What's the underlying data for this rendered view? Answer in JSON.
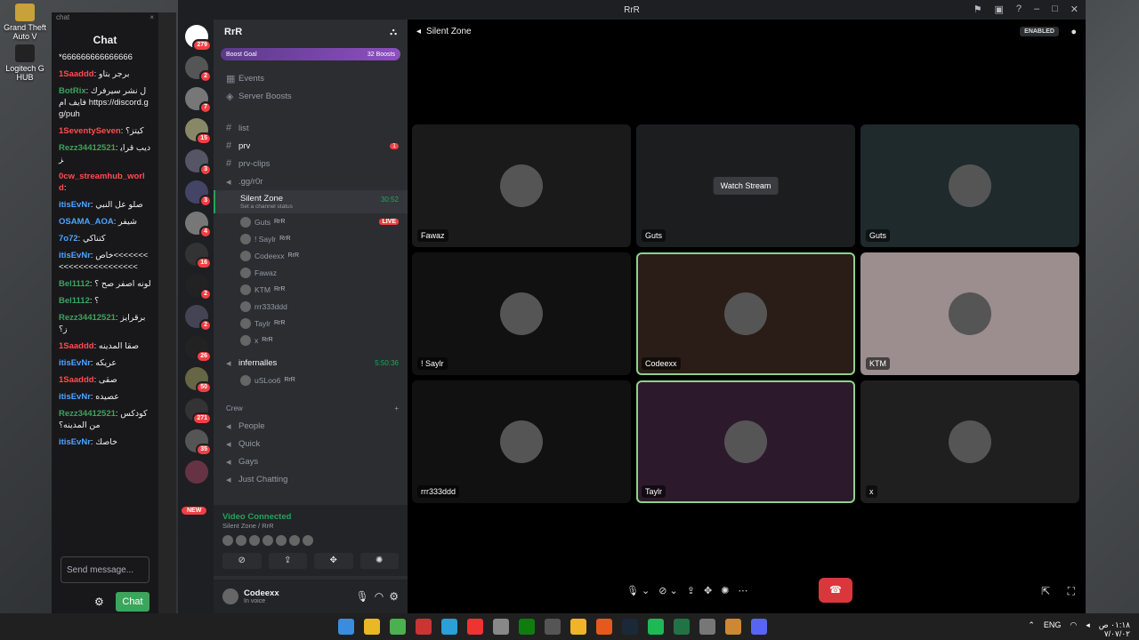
{
  "desktop": {
    "icons": [
      "Grand Theft Auto V",
      "Logitech G HUB"
    ]
  },
  "chat_panel": {
    "top_label": "chat",
    "close": "×",
    "title": "Chat",
    "messages": [
      {
        "user": "",
        "text": "*666666666666666",
        "color": "#efeff1"
      },
      {
        "user": "1Saaddd",
        "text": ": برجر بتاو",
        "color": "#ff4d4d"
      },
      {
        "user": "BotRix",
        "text": ": ل نشر سيرفرك فايف ام https://discord.gg/puh",
        "color": "#3ba55c"
      },
      {
        "user": "1SeventySeven",
        "text": ": كيتز؟",
        "color": "#ff4d4d"
      },
      {
        "user": "Rezz34412521",
        "text": ": ديب قرايز",
        "color": "#3ba55c"
      },
      {
        "user": "0cw_streamhub_world",
        "text": ":",
        "color": "#ff4d4d"
      },
      {
        "user": "itisEvNr",
        "text": ": صلو عل النبي",
        "color": "#4fa3ff"
      },
      {
        "user": "OSAMA_AOA",
        "text": ": شيفر",
        "color": "#4fa3ff"
      },
      {
        "user": "7o72",
        "text": ": كتناكي",
        "color": "#4fa3ff"
      },
      {
        "user": "itisEvNr",
        "text": ": خاص<<<<<<<<<<<<<<<<<<<<<<<",
        "color": "#4fa3ff"
      },
      {
        "user": "Bel1112",
        "text": ": لونه اصفر صح ؟",
        "color": "#3ba55c"
      },
      {
        "user": "Bel1112",
        "text": ": ؟",
        "color": "#3ba55c"
      },
      {
        "user": "Rezz34412521",
        "text": ": برقرايزز؟",
        "color": "#3ba55c"
      },
      {
        "user": "1Saaddd",
        "text": ": صقا المدينه",
        "color": "#ff4d4d"
      },
      {
        "user": "itisEvNr",
        "text": ": عريكه",
        "color": "#4fa3ff"
      },
      {
        "user": "1Saaddd",
        "text": ": صقى",
        "color": "#ff4d4d"
      },
      {
        "user": "itisEvNr",
        "text": ": عصيده",
        "color": "#4fa3ff"
      },
      {
        "user": "Rezz34412521",
        "text": ": كودكس من المدينه؟",
        "color": "#3ba55c"
      },
      {
        "user": "itisEvNr",
        "text": ": خاصك",
        "color": "#4fa3ff"
      }
    ],
    "input_placeholder": "Send message...",
    "send_label": "Chat",
    "accent": "#3ba55c"
  },
  "window": {
    "title": "RrR"
  },
  "rail": {
    "badges": [
      "279",
      "2",
      "7",
      "15",
      "3",
      "3",
      "4",
      "16",
      "2",
      "2",
      "26",
      "50",
      "271",
      "35"
    ],
    "new_label": "NEW"
  },
  "server": {
    "name": "RrR",
    "boost_goal": "Boost Goal",
    "boost_count": "32 Boosts",
    "top_items": [
      "Events",
      "Server Boosts"
    ],
    "channels": [
      {
        "name": "list",
        "bold": false
      },
      {
        "name": "prv",
        "bold": true,
        "pill": "1"
      },
      {
        "name": "prv-clips",
        "bold": false
      },
      {
        "name": ".gg/r0r",
        "bold": false
      }
    ],
    "voice1": {
      "name": "Silent Zone",
      "status": "Set a channel status",
      "timer": "30:52"
    },
    "members": [
      {
        "name": "Guts",
        "tag": "RrR",
        "live": "LIVE"
      },
      {
        "name": "! Saylr",
        "tag": "RrR"
      },
      {
        "name": "Codeexx",
        "tag": "RrR"
      },
      {
        "name": "Fawaz",
        "tag": ""
      },
      {
        "name": "KTM",
        "tag": "RrR"
      },
      {
        "name": "rrr333ddd",
        "tag": ""
      },
      {
        "name": "Taylr",
        "tag": "RrR"
      },
      {
        "name": "x",
        "tag": "RrR"
      }
    ],
    "voice2": {
      "name": "infernalles",
      "timer": "5:50:36"
    },
    "voice2_member": {
      "name": "uSLoo6",
      "tag": "RrR"
    },
    "category": "Crew",
    "category_channels": [
      "People",
      "Quick",
      "Gays",
      "Just Chatting"
    ]
  },
  "voice_panel": {
    "status": "Video Connected",
    "location": "Silent Zone / RrR"
  },
  "user": {
    "name": "Codeexx",
    "status": "In voice"
  },
  "stage": {
    "channel": "Silent Zone",
    "enabled": "ENABLED",
    "watch_stream": "Watch Stream",
    "tiles": [
      {
        "label": "Fawaz",
        "bg": "#1a1a1a",
        "speaking": false
      },
      {
        "label": "Guts",
        "bg": "#1c1d1f",
        "speaking": false,
        "stream": true
      },
      {
        "label": "Guts",
        "bg": "#1f2a2c",
        "speaking": false
      },
      {
        "label": "! Saylr",
        "bg": "#111111",
        "speaking": false
      },
      {
        "label": "Codeexx",
        "bg": "#2a1d18",
        "speaking": true
      },
      {
        "label": "KTM",
        "bg": "#9c8e8e",
        "speaking": false
      },
      {
        "label": "rrr333ddd",
        "bg": "#111111",
        "speaking": false
      },
      {
        "label": "Taylr",
        "bg": "#2c1a2c",
        "speaking": true
      },
      {
        "label": "x",
        "bg": "#1f1f1f",
        "speaking": false
      }
    ]
  },
  "taskbar": {
    "lang": "ENG",
    "time": "٠١:١٨ ص",
    "date": "٧/٠٧/٠٢"
  }
}
